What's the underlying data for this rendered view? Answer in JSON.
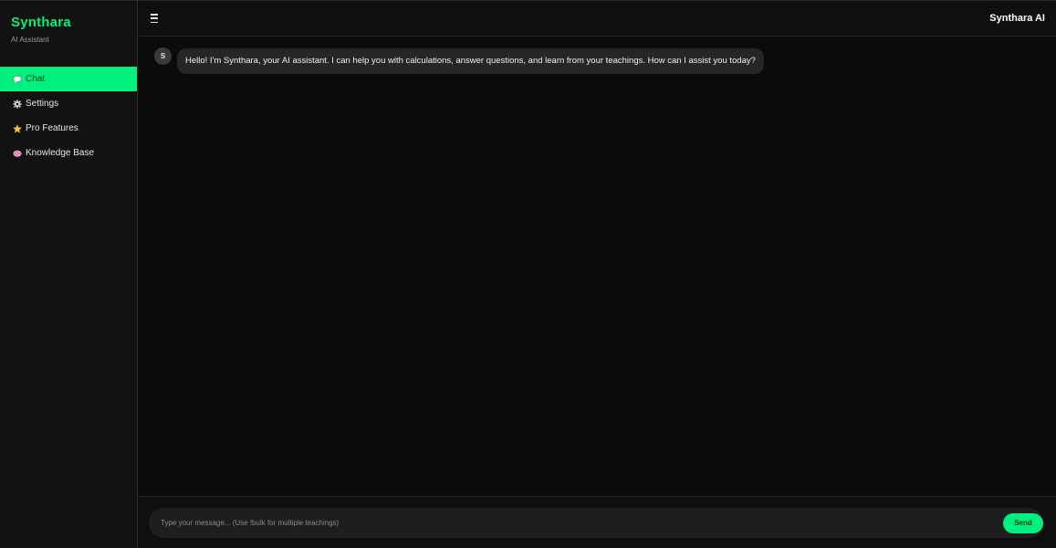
{
  "sidebar": {
    "brand_title": "Synthara",
    "brand_subtitle": "AI Assistant",
    "items": [
      {
        "label": "Chat",
        "icon": "speech-bubble-icon",
        "active": true
      },
      {
        "label": "Settings",
        "icon": "gear-icon",
        "active": false
      },
      {
        "label": "Pro Features",
        "icon": "star-icon",
        "active": false
      },
      {
        "label": "Knowledge Base",
        "icon": "brain-icon",
        "active": false
      }
    ]
  },
  "header": {
    "menu_icon": "hamburger-menu-icon",
    "title": "Synthara AI"
  },
  "messages": [
    {
      "sender_initial": "S",
      "text": "Hello! I'm Synthara, your AI assistant. I can help you with calculations, answer questions, and learn from your teachings. How can I assist you today?"
    }
  ],
  "composer": {
    "placeholder": "Type your message... (Use !bulk for multiple teachings)",
    "value": "",
    "send_label": "Send"
  },
  "colors": {
    "accent": "#00f07f",
    "background": "#0b0b0b",
    "sidebar": "#121212",
    "bubble": "#262626"
  }
}
